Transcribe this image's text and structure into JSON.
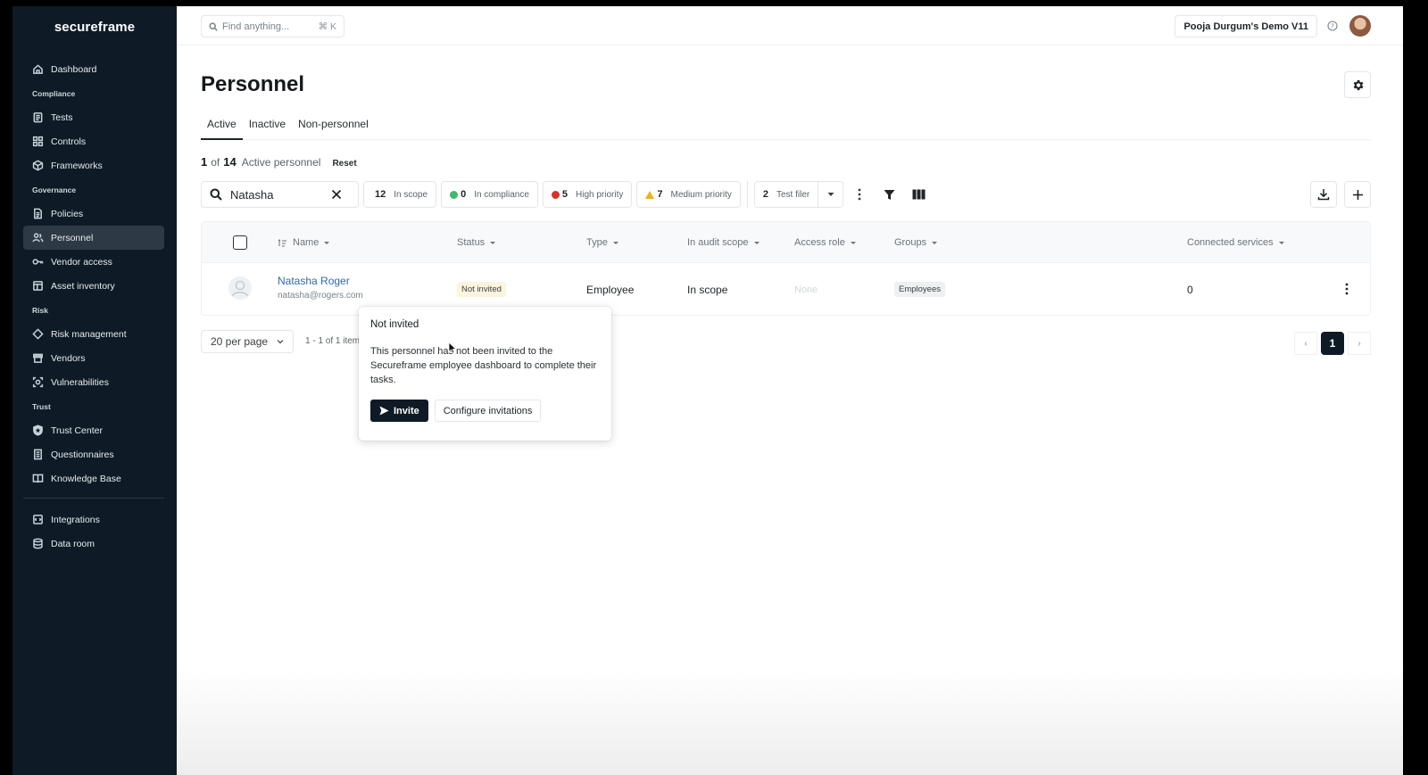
{
  "app": {
    "logo": "secureframe"
  },
  "sidebar": {
    "items": [
      {
        "type": "item",
        "label": "Dashboard",
        "icon": "home-icon"
      },
      {
        "type": "section",
        "label": "Compliance"
      },
      {
        "type": "item",
        "label": "Tests",
        "icon": "clipboard-icon"
      },
      {
        "type": "item",
        "label": "Controls",
        "icon": "grid-icon"
      },
      {
        "type": "item",
        "label": "Frameworks",
        "icon": "cube-icon"
      },
      {
        "type": "section",
        "label": "Governance"
      },
      {
        "type": "item",
        "label": "Policies",
        "icon": "document-icon"
      },
      {
        "type": "item",
        "label": "Personnel",
        "icon": "users-icon",
        "active": true
      },
      {
        "type": "item",
        "label": "Vendor access",
        "icon": "key-icon"
      },
      {
        "type": "item",
        "label": "Asset inventory",
        "icon": "inventory-icon"
      },
      {
        "type": "section",
        "label": "Risk"
      },
      {
        "type": "item",
        "label": "Risk management",
        "icon": "diamond-icon"
      },
      {
        "type": "item",
        "label": "Vendors",
        "icon": "store-icon"
      },
      {
        "type": "item",
        "label": "Vulnerabilities",
        "icon": "scan-icon"
      },
      {
        "type": "section",
        "label": "Trust"
      },
      {
        "type": "item",
        "label": "Trust Center",
        "icon": "shield-icon"
      },
      {
        "type": "item",
        "label": "Questionnaires",
        "icon": "list-doc-icon"
      },
      {
        "type": "item",
        "label": "Knowledge Base",
        "icon": "book-icon"
      },
      {
        "type": "divider"
      },
      {
        "type": "item",
        "label": "Integrations",
        "icon": "plug-icon"
      },
      {
        "type": "item",
        "label": "Data room",
        "icon": "database-icon"
      }
    ]
  },
  "topbar": {
    "search_placeholder": "Find anything...",
    "search_shortcut": "⌘ K",
    "org_name": "Pooja Durgum's Demo V11"
  },
  "page": {
    "title": "Personnel",
    "tabs": [
      {
        "label": "Active",
        "active": true
      },
      {
        "label": "Inactive"
      },
      {
        "label": "Non-personnel"
      }
    ],
    "count": {
      "shown": "1",
      "of": "of",
      "total": "14",
      "label": "Active personnel",
      "reset": "Reset"
    }
  },
  "filters": {
    "search_value": "Natasha",
    "chips": [
      {
        "count": "12",
        "label": "In scope",
        "marker": "none"
      },
      {
        "count": "0",
        "label": "In compliance",
        "marker": "green"
      },
      {
        "count": "5",
        "label": "High priority",
        "marker": "red"
      },
      {
        "count": "7",
        "label": "Medium priority",
        "marker": "warning"
      }
    ],
    "saved_filter": {
      "count": "2",
      "label": "Test filer"
    }
  },
  "table": {
    "columns": [
      "Name",
      "Status",
      "Type",
      "In audit scope",
      "Access role",
      "Groups",
      "Connected services"
    ],
    "rows": [
      {
        "name": "Natasha Roger",
        "email": "natasha@rogers.com",
        "status": "Not invited",
        "type": "Employee",
        "audit_scope": "In scope",
        "access_role": "None",
        "groups": "Employees",
        "connected_services": "0"
      }
    ]
  },
  "pagination": {
    "per_page": "20 per page",
    "range": "1 - 1 of 1 items",
    "prev": "‹",
    "current": "1",
    "next": "›"
  },
  "popover": {
    "title": "Not invited",
    "body": "This personnel has not been invited to the Secureframe employee dashboard to complete their tasks.",
    "invite_label": "Invite",
    "configure_label": "Configure invitations"
  }
}
